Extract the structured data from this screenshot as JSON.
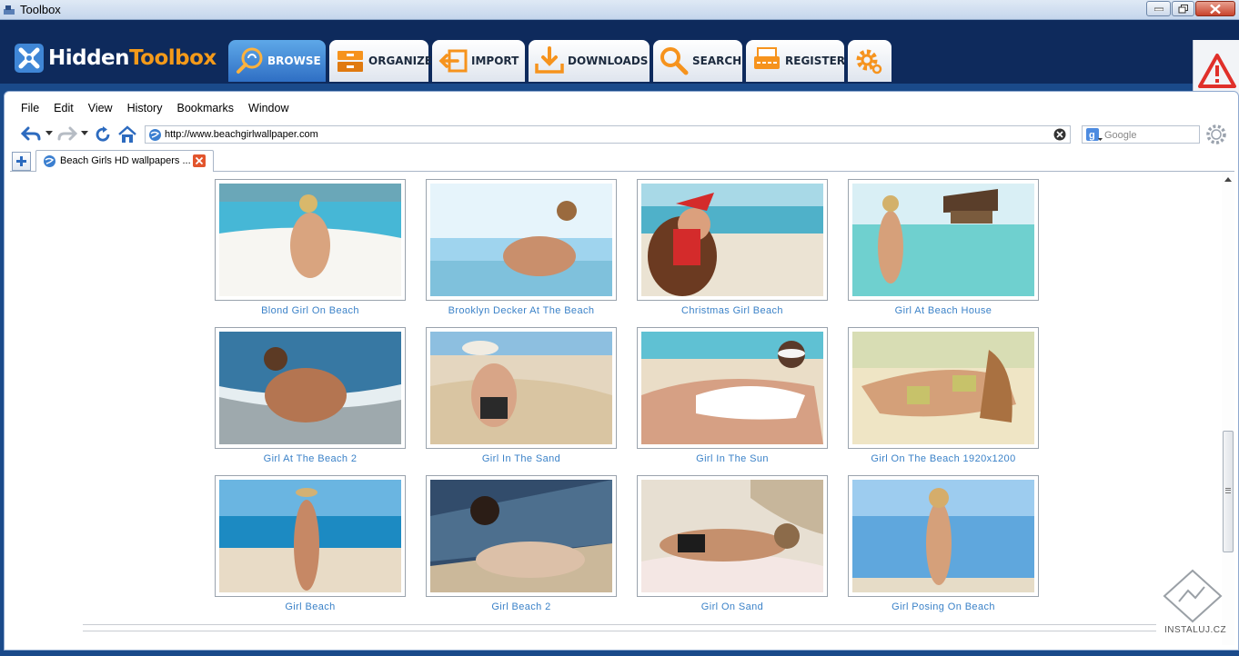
{
  "window": {
    "title": "Toolbox"
  },
  "logo": {
    "part1": "Hidden",
    "part2": "Toolbox"
  },
  "nav": {
    "tabs": [
      {
        "label": "BROWSE",
        "icon": "browse-icon",
        "active": true
      },
      {
        "label": "ORGANIZE",
        "icon": "organize-icon",
        "active": false
      },
      {
        "label": "IMPORT",
        "icon": "import-icon",
        "active": false
      },
      {
        "label": "DOWNLOADS",
        "icon": "downloads-icon",
        "active": false
      },
      {
        "label": "SEARCH",
        "icon": "search-icon",
        "active": false
      },
      {
        "label": "REGISTER",
        "icon": "register-icon",
        "active": false
      },
      {
        "label": "",
        "icon": "settings-gear-icon",
        "active": false
      }
    ]
  },
  "menu": {
    "items": [
      "File",
      "Edit",
      "View",
      "History",
      "Bookmarks",
      "Window"
    ]
  },
  "address": {
    "url": "http://www.beachgirlwallpaper.com"
  },
  "search": {
    "placeholder": "Google"
  },
  "tab": {
    "title": "Beach Girls HD wallpapers ..."
  },
  "gallery": {
    "items": [
      {
        "caption": "Blond Girl On Beach"
      },
      {
        "caption": "Brooklyn Decker At The Beach"
      },
      {
        "caption": "Christmas Girl Beach"
      },
      {
        "caption": "Girl At Beach House"
      },
      {
        "caption": "Girl At The Beach 2"
      },
      {
        "caption": "Girl In The Sand"
      },
      {
        "caption": "Girl In The Sun"
      },
      {
        "caption": "Girl On The Beach 1920x1200"
      },
      {
        "caption": "Girl Beach"
      },
      {
        "caption": "Girl Beach 2"
      },
      {
        "caption": "Girl On Sand"
      },
      {
        "caption": "Girl Posing On Beach"
      }
    ]
  },
  "watermark": {
    "text": "INSTALUJ.CZ"
  },
  "colors": {
    "header_bg": "#0e2a5c",
    "active_tab": "#3f86d6",
    "logo_accent": "#f49a1a",
    "caption_link": "#3b82c8"
  }
}
